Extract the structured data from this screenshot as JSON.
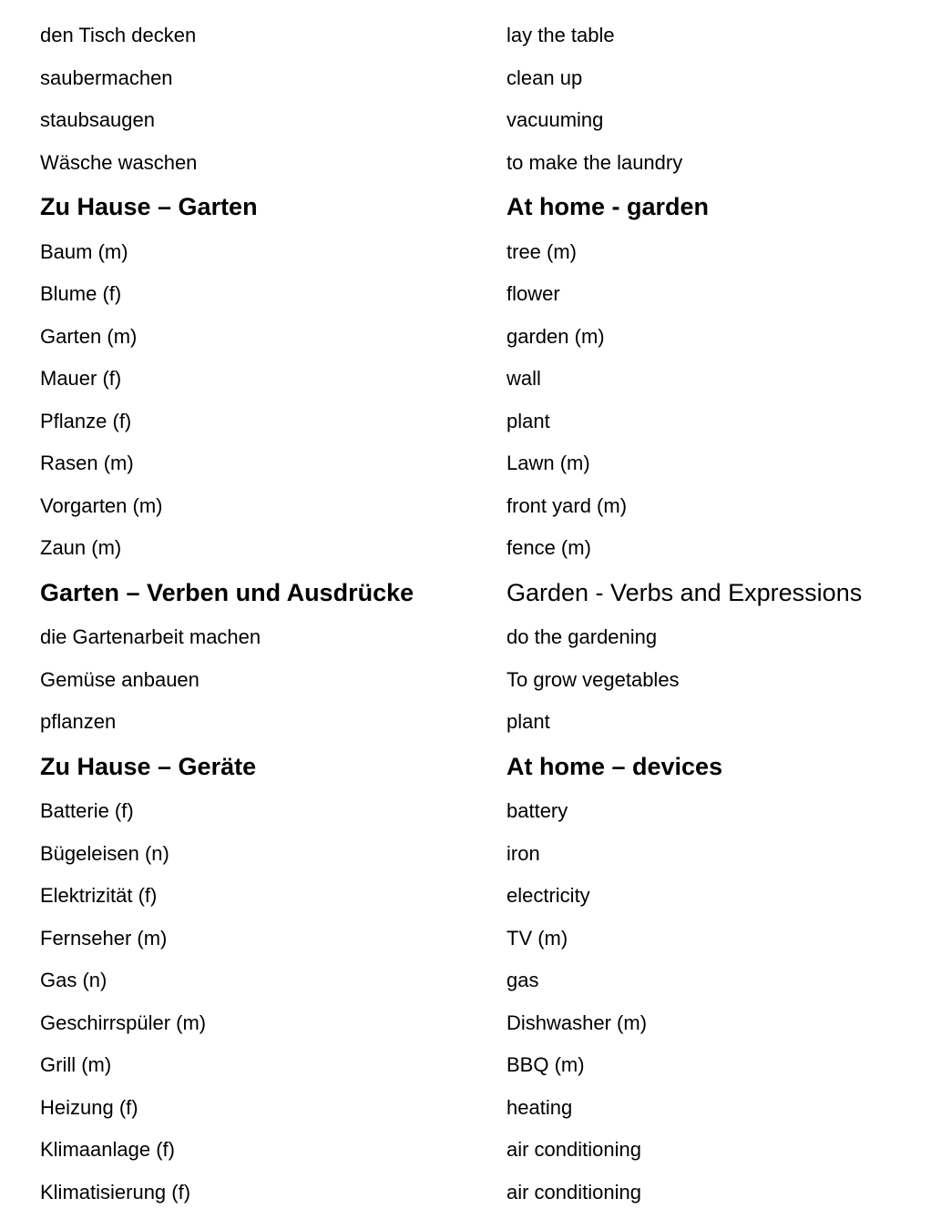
{
  "rows": [
    {
      "type": "item",
      "de": "den Tisch decken",
      "en": "lay the table"
    },
    {
      "type": "item",
      "de": "saubermachen",
      "en": "clean up"
    },
    {
      "type": "item",
      "de": "staubsaugen",
      "en": "vacuuming"
    },
    {
      "type": "item",
      "de": "Wäsche waschen",
      "en": "to make the laundry"
    },
    {
      "type": "heading",
      "de": "Zu Hause – Garten",
      "en": "At home - garden"
    },
    {
      "type": "item",
      "de": "Baum (m)",
      "en": "tree (m)"
    },
    {
      "type": "item",
      "de": "Blume (f)",
      "en": "flower"
    },
    {
      "type": "item",
      "de": "Garten (m)",
      "en": "garden (m)"
    },
    {
      "type": "item",
      "de": "Mauer (f)",
      "en": "wall"
    },
    {
      "type": "item",
      "de": "Pflanze (f)",
      "en": "plant"
    },
    {
      "type": "item",
      "de": "Rasen (m)",
      "en": "Lawn (m)"
    },
    {
      "type": "item",
      "de": "Vorgarten (m)",
      "en": "front yard (m)"
    },
    {
      "type": "item",
      "de": "Zaun (m)",
      "en": "fence (m)"
    },
    {
      "type": "heading",
      "de": "Garten – Verben und Ausdrücke",
      "en": "Garden - Verbs and Expressions",
      "en_bold": false
    },
    {
      "type": "item",
      "de": "die Gartenarbeit machen",
      "en": "do the gardening"
    },
    {
      "type": "item",
      "de": "Gemüse anbauen",
      "en": "To grow vegetables"
    },
    {
      "type": "item",
      "de": "pflanzen",
      "en": "plant"
    },
    {
      "type": "heading",
      "de": "Zu Hause – Geräte",
      "en": "At home – devices"
    },
    {
      "type": "item",
      "de": "Batterie (f)",
      "en": "battery"
    },
    {
      "type": "item",
      "de": "Bügeleisen (n)",
      "en": "iron"
    },
    {
      "type": "item",
      "de": "Elektrizität (f)",
      "en": "electricity"
    },
    {
      "type": "item",
      "de": "Fernseher (m)",
      "en": "TV (m)"
    },
    {
      "type": "item",
      "de": "Gas (n)",
      "en": "gas"
    },
    {
      "type": "item",
      "de": "Geschirrspüler (m)",
      "en": "Dishwasher (m)"
    },
    {
      "type": "item",
      "de": "Grill (m)",
      "en": "BBQ (m)"
    },
    {
      "type": "item",
      "de": "Heizung (f)",
      "en": "heating"
    },
    {
      "type": "item",
      "de": "Klimaanlage (f)",
      "en": "air conditioning"
    },
    {
      "type": "item",
      "de": "Klimatisierung (f)",
      "en": "air conditioning"
    }
  ]
}
